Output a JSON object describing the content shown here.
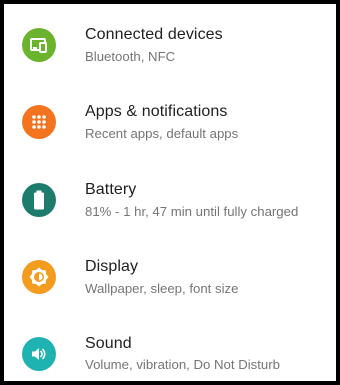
{
  "settings": {
    "items": [
      {
        "title": "Connected devices",
        "summary": "Bluetooth, NFC",
        "icon": "connected-devices-icon",
        "color": "#6ab42d"
      },
      {
        "title": "Apps & notifications",
        "summary": "Recent apps, default apps",
        "icon": "apps-grid-icon",
        "color": "#f4731f"
      },
      {
        "title": "Battery",
        "summary": "81% - 1 hr, 47 min until fully charged",
        "icon": "battery-icon",
        "color": "#1e7c6c"
      },
      {
        "title": "Display",
        "summary": "Wallpaper, sleep, font size",
        "icon": "brightness-icon",
        "color": "#f49c1e"
      },
      {
        "title": "Sound",
        "summary": "Volume, vibration, Do Not Disturb",
        "icon": "volume-icon",
        "color": "#1eb3b0"
      }
    ]
  }
}
